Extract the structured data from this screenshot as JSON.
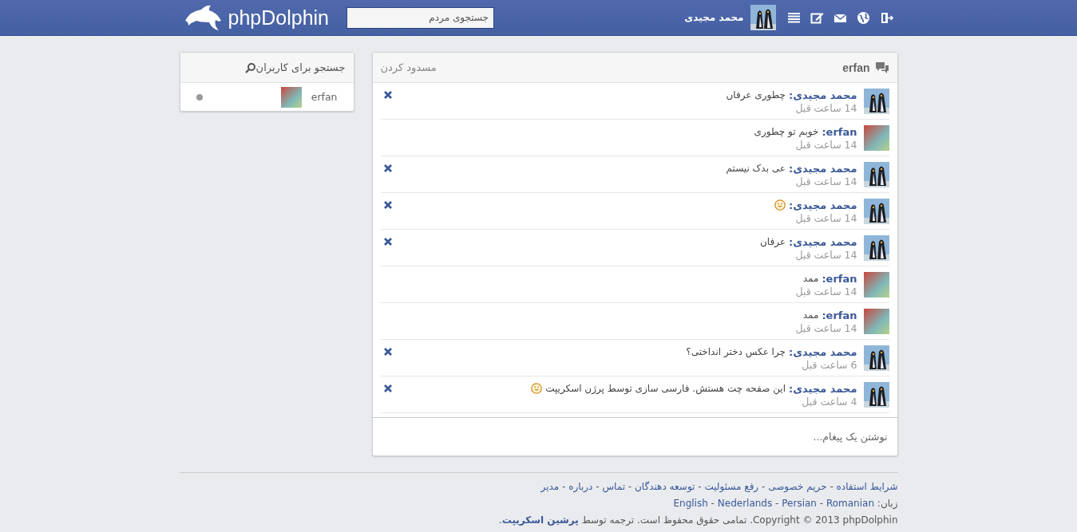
{
  "header": {
    "logo_text": "phpDolphin",
    "search": {
      "placeholder": "جستجوی مردم"
    },
    "user": {
      "name": "محمد مجیدی",
      "avatar": {
        "kind": "penguin"
      }
    },
    "icons": [
      {
        "kind": "list"
      },
      {
        "kind": "edit"
      },
      {
        "kind": "mail"
      },
      {
        "kind": "globe"
      },
      {
        "kind": "logout"
      }
    ]
  },
  "chat": {
    "title": "erfan",
    "block_link": "مسدود کردن",
    "messages": [
      {
        "author": "محمد مجیدی:",
        "avatar": {
          "kind": "penguin"
        },
        "text": "چطوری عرفان",
        "emoji": false,
        "time": "14 ساعت قبل",
        "deletable": true
      },
      {
        "author": "erfan:",
        "avatar": {
          "kind": "person"
        },
        "text": "خوبم تو چطوری",
        "emoji": false,
        "time": "14 ساعت قبل",
        "deletable": false
      },
      {
        "author": "محمد مجیدی:",
        "avatar": {
          "kind": "penguin"
        },
        "text": "عی بدک نیستم",
        "emoji": false,
        "time": "14 ساعت قبل",
        "deletable": true
      },
      {
        "author": "محمد مجیدی:",
        "avatar": {
          "kind": "penguin"
        },
        "emoji": true,
        "time": "14 ساعت قبل",
        "deletable": true
      },
      {
        "author": "محمد مجیدی:",
        "avatar": {
          "kind": "penguin"
        },
        "text": "عرفان",
        "emoji": false,
        "time": "14 ساعت قبل",
        "deletable": true
      },
      {
        "author": "erfan:",
        "avatar": {
          "kind": "person"
        },
        "text": "ممد",
        "emoji": false,
        "time": "14 ساعت قبل",
        "deletable": false
      },
      {
        "author": "erfan:",
        "avatar": {
          "kind": "person"
        },
        "text": "ممد",
        "emoji": false,
        "time": "14 ساعت قبل",
        "deletable": false
      },
      {
        "author": "محمد مجیدی:",
        "avatar": {
          "kind": "penguin"
        },
        "text": "چرا عکس دختر انداختی؟",
        "emoji": false,
        "time": "6 ساعت قبل",
        "deletable": true
      },
      {
        "author": "محمد مجیدی:",
        "avatar": {
          "kind": "penguin"
        },
        "text": "این صفحه چت هستش. فارسی سازی توسط پرژن اسکریپت",
        "emoji": true,
        "time": "4 ساعت قبل",
        "deletable": true
      }
    ],
    "compose": {
      "placeholder": "نوشتن یک پیغام..."
    }
  },
  "sidebar": {
    "title": "جستجو برای کاربران",
    "users": [
      {
        "name": "erfan",
        "avatar": {
          "kind": "person"
        },
        "online": false
      }
    ]
  },
  "footer": {
    "separator": "-",
    "links": [
      "شرایط استفاده",
      "حریم خصوصی",
      "رفع مسئولیت",
      "توسعه دهندگان",
      "تماس",
      "درباره",
      "مدیر"
    ],
    "language_label": "زبان:",
    "languages": [
      "Romanian",
      "Persian",
      "Nederlands",
      "English"
    ],
    "copyright": "Copyright © 2013 phpDolphin. تمامی حقوق محفوظ است. ترجمه توسط ",
    "credit_link": "پرشین اسکریپت",
    "credit_end": "."
  }
}
